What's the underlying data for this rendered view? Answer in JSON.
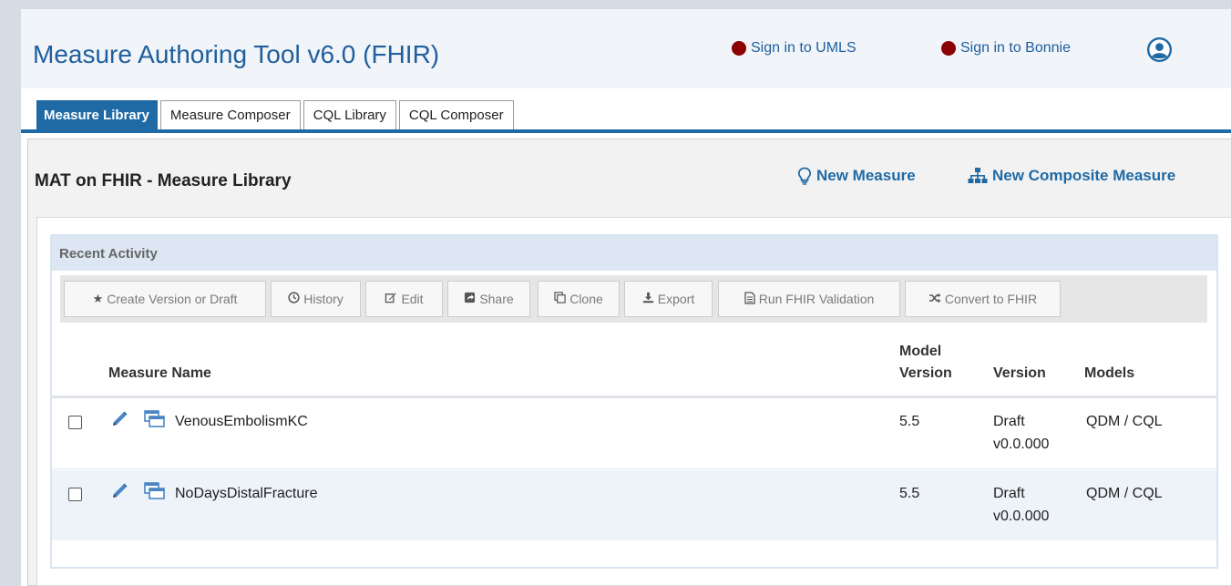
{
  "header": {
    "app_title": "Measure Authoring Tool v6.0 (FHIR)",
    "signin_umls": "Sign in to UMLS",
    "signin_bonnie": "Sign in to Bonnie",
    "status_color": "#8b0000"
  },
  "tabs": [
    {
      "label": "Measure Library",
      "active": true
    },
    {
      "label": "Measure Composer",
      "active": false
    },
    {
      "label": "CQL Library",
      "active": false
    },
    {
      "label": "CQL Composer",
      "active": false
    }
  ],
  "page": {
    "title": "MAT on FHIR - Measure Library",
    "new_measure": "New Measure",
    "new_composite": "New Composite Measure"
  },
  "recent": {
    "title": "Recent Activity",
    "toolbar": [
      {
        "icon": "star-icon",
        "label": "Create Version or Draft"
      },
      {
        "icon": "clock-icon",
        "label": "History"
      },
      {
        "icon": "edit-icon",
        "label": "Edit"
      },
      {
        "icon": "share-icon",
        "label": "Share"
      },
      {
        "icon": "clone-icon",
        "label": "Clone"
      },
      {
        "icon": "download-icon",
        "label": "Export"
      },
      {
        "icon": "document-icon",
        "label": "Run FHIR Validation"
      },
      {
        "icon": "shuffle-icon",
        "label": "Convert to FHIR"
      }
    ],
    "columns": {
      "name": "Measure Name",
      "model_version_1": "Model",
      "model_version_2": "Version",
      "version": "Version",
      "models": "Models"
    },
    "rows": [
      {
        "name": "VenousEmbolismKC",
        "model_version": "5.5",
        "version_1": "Draft",
        "version_2": "v0.0.000",
        "models": "QDM / CQL"
      },
      {
        "name": "NoDaysDistalFracture",
        "model_version": "5.5",
        "version_1": "Draft",
        "version_2": "v0.0.000",
        "models": "QDM / CQL"
      }
    ]
  },
  "colors": {
    "brand_blue": "#1f6aa5",
    "title_blue": "#1f5f9e",
    "recent_header": "#dce7f3"
  }
}
